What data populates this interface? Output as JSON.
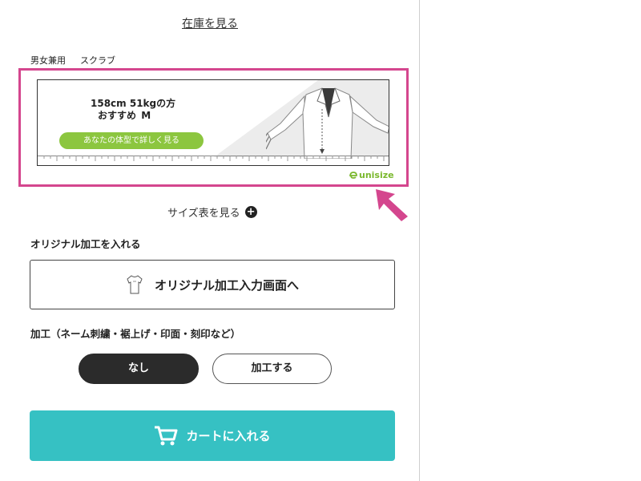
{
  "stock_link": "在庫を見る",
  "product": {
    "gender": "男女兼用",
    "category": "スクラブ"
  },
  "recommendation": {
    "line1": "158cm 51kgの方",
    "line2_prefix": "おすすめ",
    "size": "M",
    "detail_button": "あなたの体型で詳しく見る",
    "logo": "unisize",
    "accent_color": "#8cc63f",
    "highlight_color": "#d4468e"
  },
  "size_chart": {
    "label": "サイズ表を見る",
    "icon": "plus-circle-icon"
  },
  "original": {
    "heading": "オリジナル加工を入れる",
    "button_label": "オリジナル加工入力画面へ",
    "icon": "tshirt-icon"
  },
  "processing": {
    "heading": "加工（ネーム刺繍・裾上げ・印面・刻印など）",
    "options": [
      "なし",
      "加工する"
    ],
    "selected": "なし"
  },
  "cart": {
    "label": "カートに入れる",
    "icon": "cart-icon",
    "color": "#36c1c3"
  }
}
